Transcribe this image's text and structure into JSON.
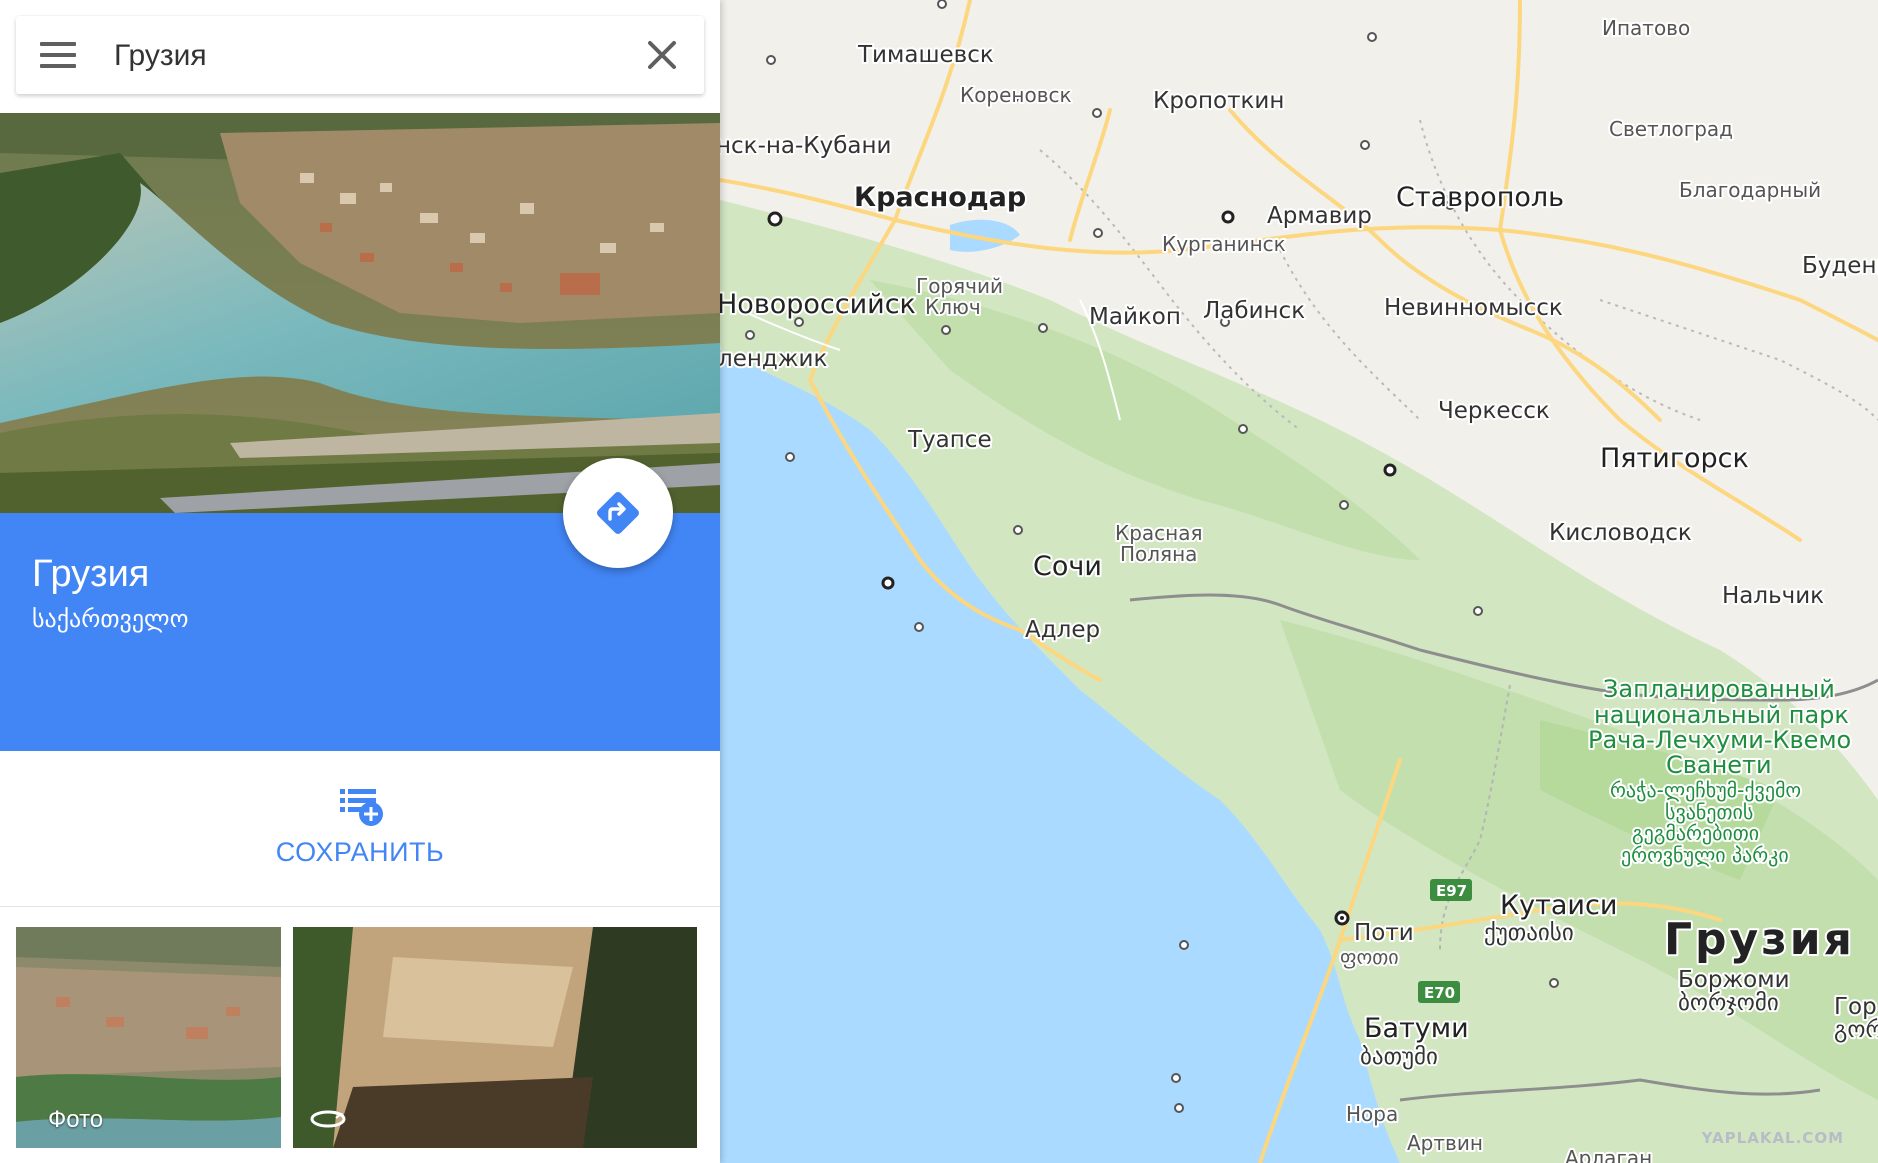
{
  "search": {
    "value": "Грузия"
  },
  "place": {
    "title": "Грузия",
    "subtitle": "საქართველო"
  },
  "actions": {
    "save_label": "СОХРАНИТЬ"
  },
  "photos": {
    "photo_label": "Фото"
  },
  "map": {
    "cities": {
      "timashevsk": "Тимашевск",
      "korenovsk": "Кореновск",
      "kropotkin": "Кропоткин",
      "ipatovo": "Ипатово",
      "svetlograd": "Светлоград",
      "slavyansk": "нск-на-Кубани",
      "krasnodar": "Краснодар",
      "armavir": "Армавир",
      "stavropol": "Ставрополь",
      "blagodarny": "Благодарный",
      "kurganinsk": "Курганинск",
      "budennovsk": "Буденн",
      "goryachy_1": "Горячий",
      "goryachy_2": "Ключ",
      "novorossiysk": "Новороссийск",
      "maykop": "Майкоп",
      "labinsk": "Лабинск",
      "nevinnomyssk": "Невинномысск",
      "gelendzhik": "ленджик",
      "cherkessk": "Черкесск",
      "tuapse": "Туапсе",
      "pyatigorsk": "Пятигорск",
      "krasnaya_1": "Красная",
      "krasnaya_2": "Поляна",
      "kislovodsk": "Кисловодск",
      "sochi": "Сочи",
      "nalchik": "Нальчик",
      "adler": "Адлер",
      "kutaisi": "Кутаиси",
      "kutaisi_ka": "ქუთაისი",
      "poti": "Поти",
      "poti_ka": "ფოთი",
      "batumi": "Батуми",
      "batumi_ka": "ბათუმი",
      "borjomi": "Боржоми",
      "borjomi_ka": "ბორჯომი",
      "gori": "Гор",
      "gori_ka": "გორ",
      "nora": "Нора",
      "artvin": "Артвин",
      "ardahan": "Арлаган"
    },
    "country_label": "Грузия",
    "park": {
      "ru_1": "Запланированный",
      "ru_2": "национальный парк",
      "ru_3": "Рача-Лечхуми-Квемо",
      "ru_4": "Сванети",
      "ka_1": "რაჭა-ლეჩხუმ-ქვემო",
      "ka_2": "სვანეთის",
      "ka_3": "გეგმარებითი",
      "ka_4": "ეროვნული პარკი"
    },
    "roads": {
      "e97": "E97",
      "e70": "E70"
    },
    "colors": {
      "sea": "#aadaff",
      "land": "#f2f0eb",
      "forest": "#c8e2b4",
      "road": "#fcd77f",
      "accent": "#4285f4"
    }
  },
  "watermark": "YAPLAKAL.COM"
}
